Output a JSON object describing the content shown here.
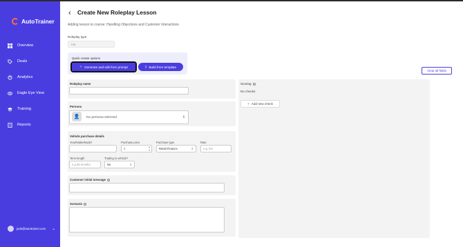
{
  "app": {
    "name": "AutoTrainer",
    "brand_color": "#4a3de0",
    "logo_accent": "#ff6b3d"
  },
  "sidebar": {
    "items": [
      {
        "label": "Overview",
        "icon": "grid-icon"
      },
      {
        "label": "Deals",
        "icon": "tag-icon"
      },
      {
        "label": "Analytics",
        "icon": "analytics-icon"
      },
      {
        "label": "Eagle Eye View",
        "icon": "eye-icon"
      },
      {
        "label": "Training",
        "icon": "graduation-icon"
      },
      {
        "label": "Reports",
        "icon": "report-icon"
      }
    ],
    "user_email": "jude@autotrainer.com"
  },
  "header": {
    "title": "Create New Roleplay Lesson",
    "subtitle": "Adding lesson to course: Handling Objections and Customer Interactions"
  },
  "roleplay_type": {
    "label": "Roleplay type",
    "value": "F&I"
  },
  "quick_create": {
    "label": "Quick create options",
    "generate_label": "Generate and edit from prompt",
    "template_label": "Build from template"
  },
  "clear_label": "Clear all fields",
  "form": {
    "roleplay_name_label": "Roleplay name",
    "persona_label": "Persona",
    "persona_value": "No persona selected",
    "vehicle_label": "Vehicle purchase details",
    "ymm_label": "Year/Make/Model",
    "price_label": "Purchase price",
    "price_placeholder": "$",
    "ptype_label": "Purchase type",
    "ptype_value": "Retail Finance",
    "rate_label": "Rate",
    "rate_placeholder": "e.g. 5%",
    "term_label": "Term length",
    "term_placeholder": "e.g 60 months",
    "trade_label": "Trading in vehicle?",
    "trade_value": "No",
    "initial_msg_label": "Customer initial message",
    "scenario_label": "Scenario"
  },
  "scoring": {
    "title": "Scoring",
    "empty": "No checks",
    "add_label": "Add new check"
  }
}
